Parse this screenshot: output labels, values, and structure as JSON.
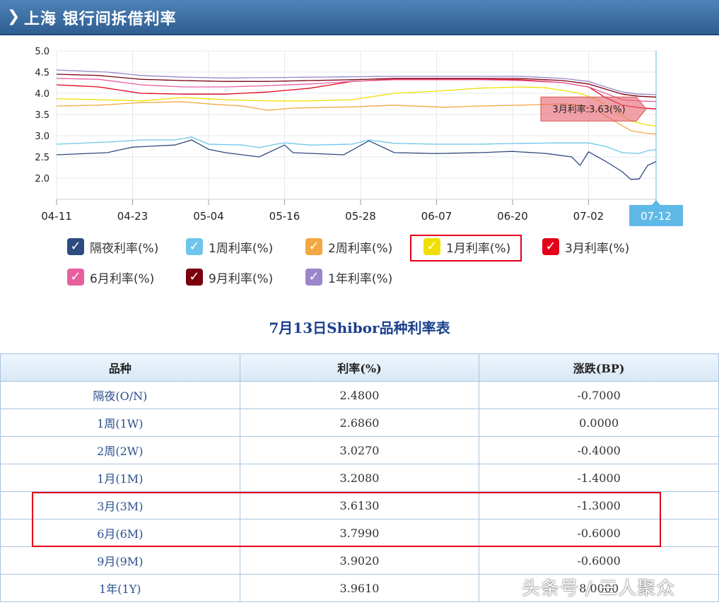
{
  "header": {
    "title": "上海  银行间拆借利率"
  },
  "chart_data": {
    "type": "line",
    "ylim": [
      1.5,
      5.0
    ],
    "yticks": [
      "5.0",
      "4.5",
      "4.0",
      "3.5",
      "3.0",
      "2.5",
      "2.0"
    ],
    "x_labels": [
      "04-11",
      "04-23",
      "05-04",
      "05-16",
      "05-28",
      "06-07",
      "06-20",
      "07-02",
      "07-12"
    ],
    "x_label_index": [
      0,
      9,
      18,
      27,
      36,
      45,
      54,
      63,
      71
    ],
    "n_points": 72,
    "tooltip": "3月利率:3.63(%)",
    "series": [
      {
        "name": "隔夜利率(%)",
        "color": "#2e4b80",
        "anchors": [
          [
            0,
            2.55
          ],
          [
            6,
            2.6
          ],
          [
            9,
            2.73
          ],
          [
            14,
            2.78
          ],
          [
            16,
            2.9
          ],
          [
            18,
            2.68
          ],
          [
            20,
            2.6
          ],
          [
            24,
            2.5
          ],
          [
            27,
            2.78
          ],
          [
            28,
            2.6
          ],
          [
            34,
            2.55
          ],
          [
            37,
            2.88
          ],
          [
            40,
            2.6
          ],
          [
            45,
            2.58
          ],
          [
            50,
            2.6
          ],
          [
            54,
            2.63
          ],
          [
            58,
            2.58
          ],
          [
            61,
            2.5
          ],
          [
            62,
            2.3
          ],
          [
            63,
            2.62
          ],
          [
            65,
            2.4
          ],
          [
            67,
            2.15
          ],
          [
            68,
            1.97
          ],
          [
            69,
            1.98
          ],
          [
            70,
            2.3
          ],
          [
            72,
            2.48
          ]
        ]
      },
      {
        "name": "1周利率(%)",
        "color": "#6fc6ea",
        "anchors": [
          [
            0,
            2.8
          ],
          [
            6,
            2.85
          ],
          [
            10,
            2.9
          ],
          [
            14,
            2.9
          ],
          [
            16,
            2.97
          ],
          [
            18,
            2.8
          ],
          [
            22,
            2.78
          ],
          [
            24,
            2.72
          ],
          [
            26,
            2.8
          ],
          [
            27,
            2.83
          ],
          [
            30,
            2.78
          ],
          [
            35,
            2.8
          ],
          [
            37,
            2.9
          ],
          [
            40,
            2.82
          ],
          [
            45,
            2.8
          ],
          [
            50,
            2.8
          ],
          [
            55,
            2.82
          ],
          [
            60,
            2.83
          ],
          [
            63,
            2.83
          ],
          [
            65,
            2.75
          ],
          [
            67,
            2.6
          ],
          [
            69,
            2.58
          ],
          [
            70,
            2.65
          ],
          [
            72,
            2.686
          ]
        ]
      },
      {
        "name": "2周利率(%)",
        "color": "#f4a741",
        "anchors": [
          [
            0,
            3.7
          ],
          [
            5,
            3.72
          ],
          [
            10,
            3.78
          ],
          [
            15,
            3.8
          ],
          [
            18,
            3.75
          ],
          [
            22,
            3.7
          ],
          [
            25,
            3.6
          ],
          [
            28,
            3.65
          ],
          [
            35,
            3.68
          ],
          [
            40,
            3.72
          ],
          [
            46,
            3.67
          ],
          [
            50,
            3.7
          ],
          [
            55,
            3.72
          ],
          [
            60,
            3.75
          ],
          [
            62,
            3.72
          ],
          [
            64,
            3.6
          ],
          [
            66,
            3.35
          ],
          [
            68,
            3.12
          ],
          [
            70,
            3.05
          ],
          [
            72,
            3.027
          ]
        ]
      },
      {
        "name": "1月利率(%)",
        "color": "#f0e000",
        "anchors": [
          [
            0,
            3.87
          ],
          [
            5,
            3.85
          ],
          [
            10,
            3.82
          ],
          [
            15,
            3.9
          ],
          [
            20,
            3.85
          ],
          [
            25,
            3.82
          ],
          [
            30,
            3.82
          ],
          [
            35,
            3.85
          ],
          [
            40,
            4.0
          ],
          [
            45,
            4.05
          ],
          [
            50,
            4.12
          ],
          [
            55,
            4.15
          ],
          [
            58,
            4.13
          ],
          [
            62,
            4.0
          ],
          [
            64,
            3.85
          ],
          [
            66,
            3.6
          ],
          [
            68,
            3.35
          ],
          [
            70,
            3.25
          ],
          [
            72,
            3.208
          ]
        ]
      },
      {
        "name": "3月利率(%)",
        "color": "#e3001b",
        "anchors": [
          [
            0,
            4.2
          ],
          [
            5,
            4.15
          ],
          [
            10,
            4.0
          ],
          [
            15,
            3.98
          ],
          [
            20,
            3.98
          ],
          [
            25,
            4.03
          ],
          [
            30,
            4.12
          ],
          [
            35,
            4.28
          ],
          [
            40,
            4.33
          ],
          [
            50,
            4.33
          ],
          [
            55,
            4.32
          ],
          [
            60,
            4.25
          ],
          [
            63,
            4.15
          ],
          [
            65,
            3.9
          ],
          [
            67,
            3.72
          ],
          [
            69,
            3.66
          ],
          [
            71,
            3.63
          ],
          [
            72,
            3.613
          ]
        ]
      },
      {
        "name": "6月利率(%)",
        "color": "#e85f9f",
        "anchors": [
          [
            0,
            4.35
          ],
          [
            5,
            4.33
          ],
          [
            10,
            4.2
          ],
          [
            15,
            4.15
          ],
          [
            20,
            4.15
          ],
          [
            25,
            4.18
          ],
          [
            30,
            4.22
          ],
          [
            35,
            4.28
          ],
          [
            40,
            4.32
          ],
          [
            50,
            4.32
          ],
          [
            55,
            4.3
          ],
          [
            60,
            4.25
          ],
          [
            63,
            4.15
          ],
          [
            65,
            4.0
          ],
          [
            67,
            3.85
          ],
          [
            69,
            3.82
          ],
          [
            72,
            3.799
          ]
        ]
      },
      {
        "name": "9月利率(%)",
        "color": "#7a0010",
        "anchors": [
          [
            0,
            4.45
          ],
          [
            5,
            4.42
          ],
          [
            10,
            4.33
          ],
          [
            15,
            4.3
          ],
          [
            20,
            4.28
          ],
          [
            25,
            4.28
          ],
          [
            30,
            4.3
          ],
          [
            35,
            4.32
          ],
          [
            40,
            4.35
          ],
          [
            50,
            4.35
          ],
          [
            55,
            4.35
          ],
          [
            60,
            4.3
          ],
          [
            63,
            4.22
          ],
          [
            65,
            4.1
          ],
          [
            67,
            3.98
          ],
          [
            69,
            3.93
          ],
          [
            72,
            3.902
          ]
        ]
      },
      {
        "name": "1年利率(%)",
        "color": "#9a86c8",
        "anchors": [
          [
            0,
            4.55
          ],
          [
            6,
            4.5
          ],
          [
            10,
            4.42
          ],
          [
            15,
            4.38
          ],
          [
            20,
            4.36
          ],
          [
            25,
            4.37
          ],
          [
            30,
            4.38
          ],
          [
            35,
            4.39
          ],
          [
            40,
            4.4
          ],
          [
            50,
            4.4
          ],
          [
            55,
            4.4
          ],
          [
            60,
            4.35
          ],
          [
            63,
            4.28
          ],
          [
            65,
            4.15
          ],
          [
            67,
            4.03
          ],
          [
            69,
            3.98
          ],
          [
            72,
            3.961
          ]
        ]
      }
    ]
  },
  "legend": [
    {
      "label": "隔夜利率(%)",
      "color": "#2e4b80"
    },
    {
      "label": "1周利率(%)",
      "color": "#6fc6ea"
    },
    {
      "label": "2周利率(%)",
      "color": "#f4a741"
    },
    {
      "label": "1月利率(%)",
      "color": "#f0e000"
    },
    {
      "label": "3月利率(%)",
      "color": "#e3001b"
    },
    {
      "label": "6月利率(%)",
      "color": "#e85f9f"
    },
    {
      "label": "9月利率(%)",
      "color": "#7a0010"
    },
    {
      "label": "1年利率(%)",
      "color": "#9a86c8"
    }
  ],
  "table": {
    "title": "7月13日Shibor品种利率表",
    "headers": [
      "品种",
      "利率(%)",
      "涨跌(BP)"
    ],
    "rows": [
      [
        "隔夜(O/N)",
        "2.4800",
        "-0.7000"
      ],
      [
        "1周(1W)",
        "2.6860",
        "0.0000"
      ],
      [
        "2周(2W)",
        "3.0270",
        "-0.4000"
      ],
      [
        "1月(1M)",
        "3.2080",
        "-1.4000"
      ],
      [
        "3月(3M)",
        "3.6130",
        "-1.3000"
      ],
      [
        "6月(6M)",
        "3.7990",
        "-0.6000"
      ],
      [
        "9月(9M)",
        "3.9020",
        "-0.6000"
      ],
      [
        "1年(1Y)",
        "3.9610",
        "8.0000"
      ]
    ]
  },
  "watermark": "头条号 / 三人聚众"
}
